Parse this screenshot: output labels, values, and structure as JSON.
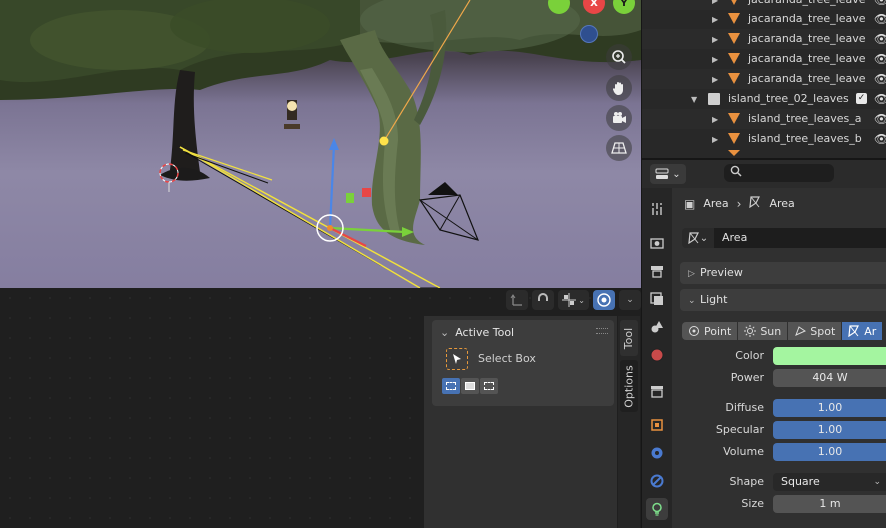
{
  "viewport": {
    "gizmo": {
      "x_label": "X",
      "y_label": "Y"
    }
  },
  "sidebar": {
    "tabs": [
      "Tool",
      "Options"
    ],
    "active_tool_panel": {
      "title": "Active Tool",
      "tool_label": "Select Box"
    }
  },
  "outliner": {
    "rows": [
      {
        "label": "jacaranda_tree_leave",
        "type": "mesh"
      },
      {
        "label": "jacaranda_tree_leave",
        "type": "mesh"
      },
      {
        "label": "jacaranda_tree_leave",
        "type": "mesh"
      },
      {
        "label": "jacaranda_tree_leave",
        "type": "mesh"
      },
      {
        "label": "jacaranda_tree_leave",
        "type": "mesh"
      },
      {
        "label": "island_tree_02_leaves",
        "type": "collection"
      },
      {
        "label": "island_tree_leaves_a",
        "type": "mesh"
      },
      {
        "label": "island_tree_leaves_b",
        "type": "mesh"
      }
    ]
  },
  "properties": {
    "breadcrumb": {
      "object": "Area",
      "data": "Area"
    },
    "datablock_name": "Area",
    "sections": {
      "preview": "Preview",
      "light": "Light"
    },
    "light_types": [
      "Point",
      "Sun",
      "Spot",
      "Ar"
    ],
    "active_light_type": "Ar",
    "fields": {
      "color_label": "Color",
      "color_value": "#a4f5a0",
      "power_label": "Power",
      "power_value": "404 W",
      "diffuse_label": "Diffuse",
      "diffuse_value": "1.00",
      "specular_label": "Specular",
      "specular_value": "1.00",
      "volume_label": "Volume",
      "volume_value": "1.00",
      "shape_label": "Shape",
      "shape_value": "Square",
      "size_label": "Size",
      "size_value": "1 m"
    }
  },
  "colors": {
    "accent_blue": "#4772b3",
    "light_color": "#a4f5a0",
    "object_orange": "#e9913f"
  }
}
